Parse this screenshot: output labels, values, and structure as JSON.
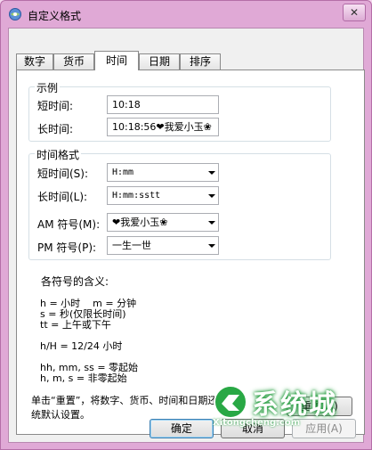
{
  "window": {
    "title": "自定义格式",
    "close_label": "✕"
  },
  "tabs": [
    {
      "label": "数字",
      "active": false
    },
    {
      "label": "货币",
      "active": false
    },
    {
      "label": "时间",
      "active": true
    },
    {
      "label": "日期",
      "active": false
    },
    {
      "label": "排序",
      "active": false
    }
  ],
  "sample": {
    "legend": "示例",
    "short_label": "短时间:",
    "short_value": "10:18",
    "long_label": "长时间:",
    "long_value": "10:18:56❤我爱小玉❀"
  },
  "time_format": {
    "legend": "时间格式",
    "short_label": "短时间(S):",
    "short_value": "H:mm",
    "long_label": "长时间(L):",
    "long_value": "H:mm:sstt",
    "am_label": "AM 符号(M):",
    "am_value": "❤我爱小玉❀",
    "pm_label": "PM 符号(P):",
    "pm_value": "一生一世"
  },
  "explanation": {
    "heading": "各符号的含义:",
    "line1": "h = 小时    m = 分钟",
    "line2": "s = 秒(仅限长时间)",
    "line3": "tt = 上午或下午",
    "line4": "h/H = 12/24 小时",
    "line5": "hh, mm, ss = 零起始",
    "line6": "h, m, s = 非零起始"
  },
  "reset": {
    "text_line1": "单击“重置”，将数字、货币、时间和日期还原到系",
    "text_line2": "统默认设置。",
    "button_label": "重置(R)"
  },
  "footer": {
    "ok_label": "确定",
    "cancel_label": "取消",
    "apply_label": "应用(A)"
  },
  "watermark": {
    "text": "系统城",
    "sub": "Xitongcheng.com"
  },
  "colors": {
    "frame": "#e0a9d6",
    "accent": "#3c7fb1",
    "watermark": "#1f9a3a"
  }
}
